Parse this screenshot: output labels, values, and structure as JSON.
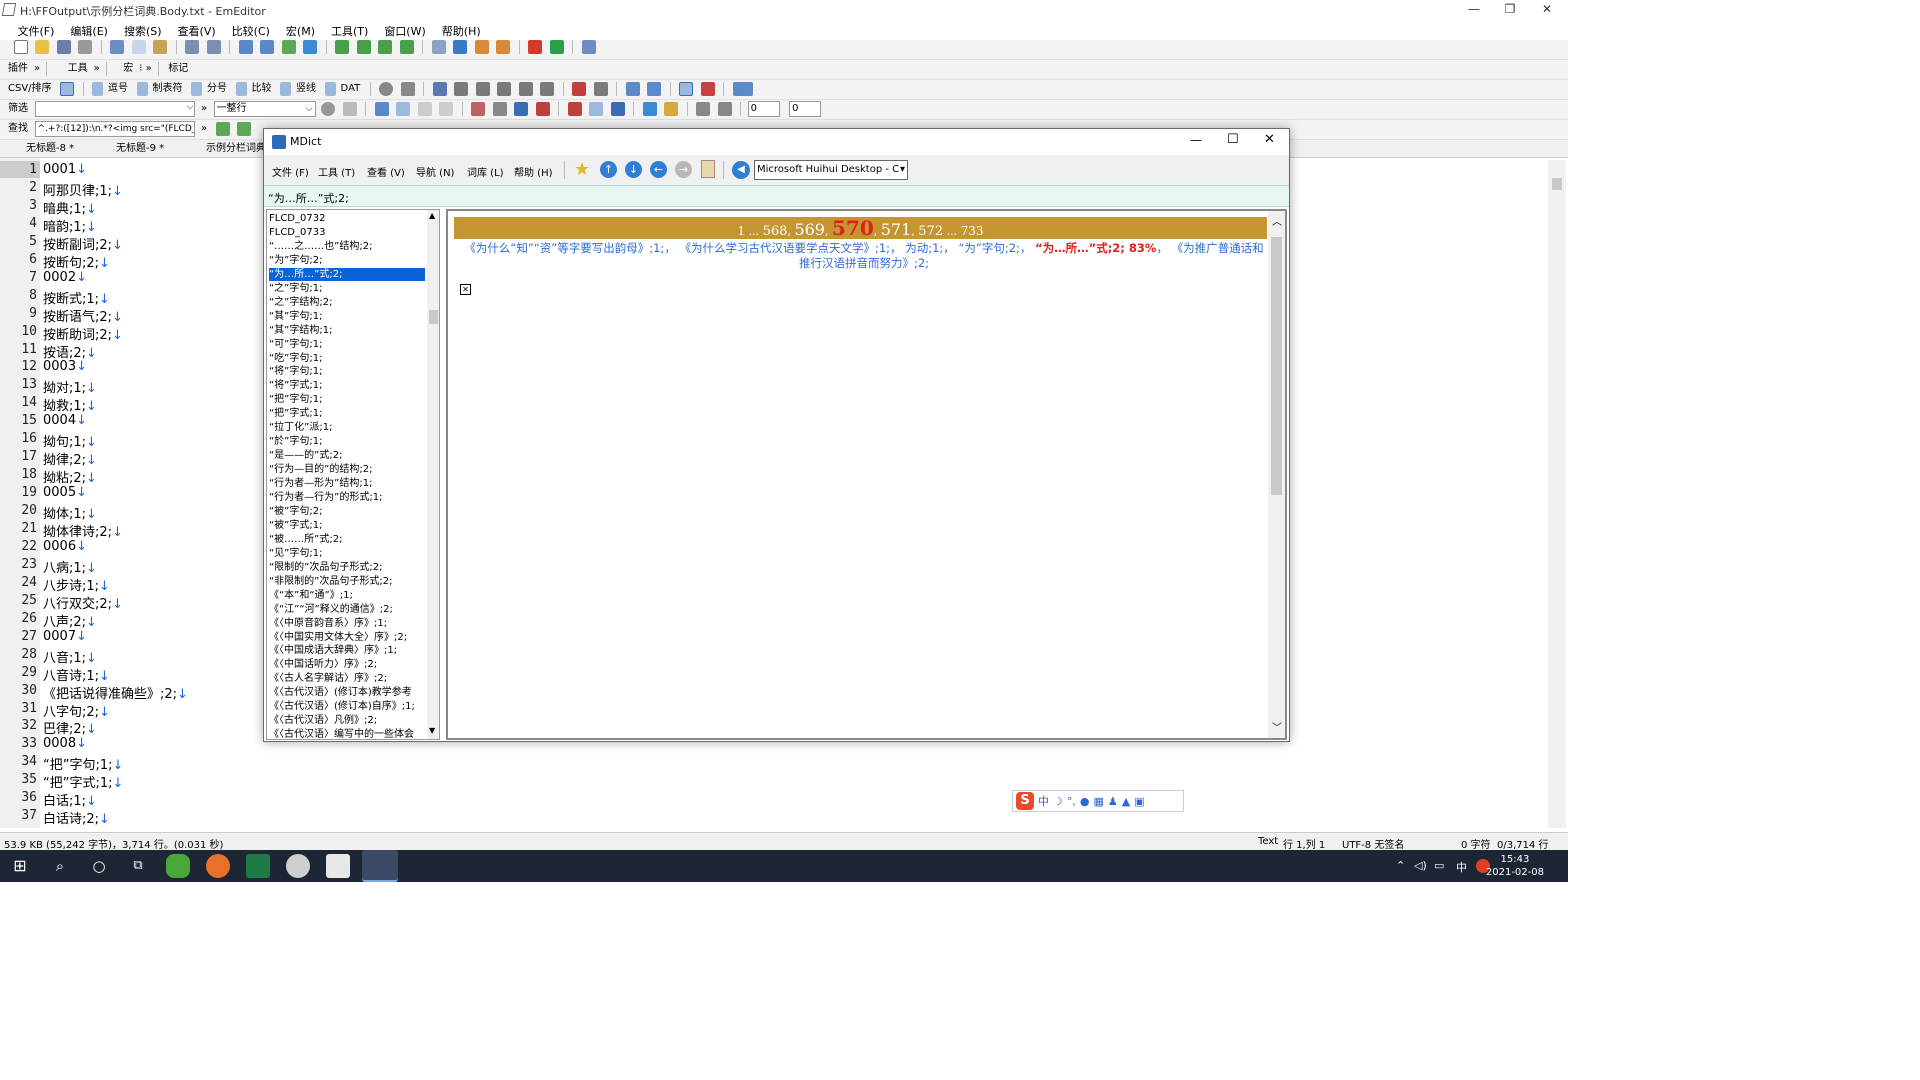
{
  "window": {
    "title": "H:\\FFOutput\\示例分栏词典.Body.txt - EmEditor",
    "minimize": "—",
    "restore": "❐",
    "close": "✕"
  },
  "menu": [
    "文件(F)",
    "编辑(E)",
    "搜索(S)",
    "查看(V)",
    "比较(C)",
    "宏(M)",
    "工具(T)",
    "窗口(W)",
    "帮助(H)"
  ],
  "toolbar3": {
    "plugins": "插件",
    "tools": "工具",
    "macro": "宏",
    "mark": "标记"
  },
  "toolbar4": {
    "csv": "CSV/排序",
    "comma": "逗号",
    "tab": "制表符",
    "semicolon": "分号",
    "compare": "比较",
    "pipe": "竖线",
    "dat": "DAT"
  },
  "filterbar": {
    "label": "筛选",
    "mode": "一整行",
    "num1": "0",
    "num2": "0"
  },
  "findbar": {
    "label": "查找",
    "query": "^.+?:([12]):\\n.*?<img src=\"(FLCD_\\d{"
  },
  "tabs": [
    "无标题-8 *",
    "无标题-9 *",
    "示例分栏词典"
  ],
  "editor": {
    "lines": [
      "1",
      "2",
      "3",
      "4",
      "5",
      "6",
      "7",
      "8",
      "9",
      "10",
      "11",
      "12",
      "13",
      "14",
      "15",
      "16",
      "17",
      "18",
      "19",
      "20",
      "21",
      "22",
      "23",
      "24",
      "25",
      "26",
      "27",
      "28",
      "29",
      "30",
      "31",
      "32",
      "33",
      "34",
      "35",
      "36",
      "37"
    ],
    "text": [
      "0001",
      "阿那贝律;1;",
      "暗典;1;",
      "暗韵;1;",
      "按断副词;2;",
      "按断句;2;",
      "0002",
      "按断式;1;",
      "按断语气;2;",
      "按断助词;2;",
      "按语;2;",
      "0003",
      "拗对;1;",
      "拗救;1;",
      "0004",
      "拗句;1;",
      "拗律;2;",
      "拗粘;2;",
      "0005",
      "拗体;1;",
      "拗体律诗;2;",
      "0006",
      "八病;1;",
      "八步诗;1;",
      "八行双交;2;",
      "八声;2;",
      "0007",
      "八音;1;",
      "八音诗;1;",
      "《把话说得准确些》;2;",
      "八字句;2;",
      "巴律;2;",
      "0008",
      "“把”字句;1;",
      "“把”字式;1;",
      "白话;1;",
      "白话诗;2;"
    ],
    "return_glyph": "↓"
  },
  "status": {
    "size": "53.9 KB (55,242 字节)，3,714 行。(0.031 秒)",
    "mode": "Text",
    "pos": "行 1,列 1",
    "enc": "UTF-8 无签名",
    "chars": "0 字符",
    "lines": "0/3,714 行"
  },
  "taskbar": {
    "time": "15:43",
    "date": "2021-02-08",
    "ime": "中"
  },
  "mdict": {
    "title": "MDict",
    "menu": [
      "文件 (F)",
      "工具 (T)",
      "查看 (V)",
      "导航 (N)",
      "词库 (L)",
      "帮助 (H)"
    ],
    "dict": "Microsoft Huihui Desktop - C",
    "search": "“为…所…”式;2;",
    "list": [
      "FLCD_0732",
      "FLCD_0733",
      "“……之……也”结构;2;",
      "“为”字句;2;",
      "“为…所…”式;2;",
      "“之”字句;1;",
      "“之”字结构;2;",
      "“其”字句;1;",
      "“其”字结构;1;",
      "“可”字句;1;",
      "“吃”字句;1;",
      "“将”字句;1;",
      "“将”字式;1;",
      "“把”字句;1;",
      "“把”字式;1;",
      "“拉丁化”派;1;",
      "“於”字句;1;",
      "“是——的”式;2;",
      "“行为—目的”的结构;2;",
      "“行为者—形为”结构;1;",
      "“行为者—行为”的形式;1;",
      "“被”字句;2;",
      "“被”字式;1;",
      "“被……所”式;2;",
      "“见”字句;1;",
      "“限制的”次品句子形式;2;",
      "“非限制的”次品句子形式;2;",
      "《“本”和“通”》;1;",
      "《“江”“河”释义的通信》;2;",
      "《〈中原音韵音系〉序》;1;",
      "《〈中国实用文体大全〉序》;2;",
      "《〈中国成语大辞典〉序》;1;",
      "《〈中国话听力〉序》;2;",
      "《〈古人名字解诂〉序》;2;",
      "《〈古代汉语〉(修订本)教学参考",
      "《〈古代汉语〉(修订本)自序》;1;",
      "《〈古代汉语〉凡例》;2;",
      "《〈古代汉语〉编写中的一些体会"
    ],
    "selected_index": 4,
    "pager": {
      "first": "1",
      "e1": "...",
      "p568": "568",
      "p569": "569",
      "current": "570",
      "p571": "571",
      "p572": "572",
      "e2": "...",
      "last": "733"
    },
    "defs": {
      "a": "《为什么“知”“资”等字要写出韵母》;1;",
      "b": "《为什么学习古代汉语要学点天文学》;1;",
      "c": "为动;1;",
      "d": "“为”字句;2;",
      "e": "“为…所…”式;2; 83%",
      "f": "《为推广普通话和推行汉语拼音而努力》;2;",
      "sep": "，"
    }
  }
}
